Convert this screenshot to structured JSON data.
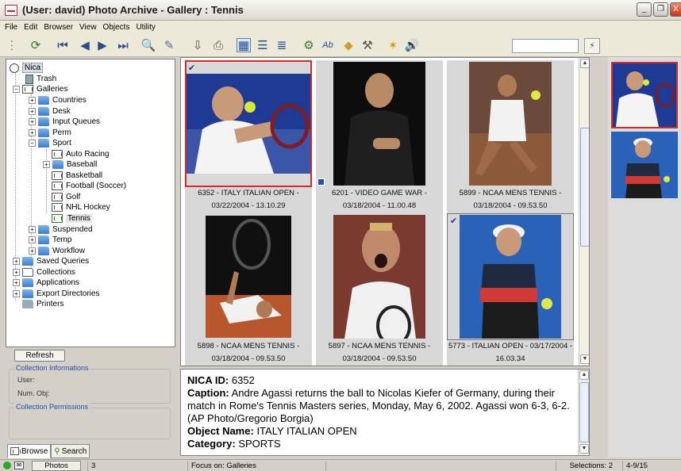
{
  "window": {
    "title": "(User: david) Photo Archive - Gallery : Tennis"
  },
  "menu": [
    "File",
    "Edit",
    "Browser",
    "View",
    "Objects",
    "Utility"
  ],
  "tree": {
    "root": "Nica",
    "trash": "Trash",
    "galleries": "Galleries",
    "countries": "Countries",
    "desk": "Desk",
    "input_queues": "Input Queues",
    "perm": "Perm",
    "sport": "Sport",
    "auto_racing": "Auto Racing",
    "baseball": "Baseball",
    "basketball": "Basketball",
    "football": "Football (Soccer)",
    "golf": "Golf",
    "nhl": "NHL Hockey",
    "tennis": "Tennis",
    "suspended": "Suspended",
    "temp": "Temp",
    "workflow": "Workflow",
    "saved_queries": "Saved Queries",
    "collections": "Collections",
    "applications": "Applications",
    "export_dirs": "Export Directories",
    "printers": "Printers"
  },
  "left": {
    "refresh": "Refresh",
    "coll_info_title": "Collection Informations",
    "user_label": "User:",
    "numobj_label": "Num. Obj:",
    "coll_perm_title": "Collection Permissions",
    "tab_browse": "Browse",
    "tab_search": "Search"
  },
  "photos": [
    {
      "line1": "6352 - ITALY ITALIAN OPEN -",
      "line2": "03/22/2004 - 13.10.29"
    },
    {
      "line1": "6201 - VIDEO GAME WAR -",
      "line2": "03/18/2004 - 11.00.48"
    },
    {
      "line1": "5899 - NCAA MENS TENNIS -",
      "line2": "03/18/2004 - 09.53.50"
    },
    {
      "line1": "5898 - NCAA MENS TENNIS -",
      "line2": "03/18/2004 - 09.53.50"
    },
    {
      "line1": "5897 - NCAA MENS TENNIS -",
      "line2": "03/18/2004 - 09.53.50"
    },
    {
      "line1": "5773 - ITALIAN OPEN - 03/17/2004 -",
      "line2": "16.03.34"
    }
  ],
  "details": {
    "id_label": "NICA ID:",
    "id_value": "6352",
    "caption_label": "Caption:",
    "caption_value": "Andre Agassi returns the ball to Nicolas Kiefer of Germany, during their match in Rome's Tennis Masters series, Monday, May 6, 2002. Agassi won 6-3, 6-2. (AP Photo/Gregorio Borgia)",
    "objname_label": "Object Name:",
    "objname_value": "ITALY ITALIAN OPEN",
    "category_label": "Category:",
    "category_value": "SPORTS"
  },
  "status": {
    "photos_btn": "Photos",
    "count": "3",
    "focus": "Focus on: Galleries",
    "selections": "Selections: 2",
    "date": "4-9/15"
  },
  "colors": {
    "selection_border": "#d42a2a",
    "folder": "#3d7dcf",
    "group_title": "#2050a8"
  }
}
